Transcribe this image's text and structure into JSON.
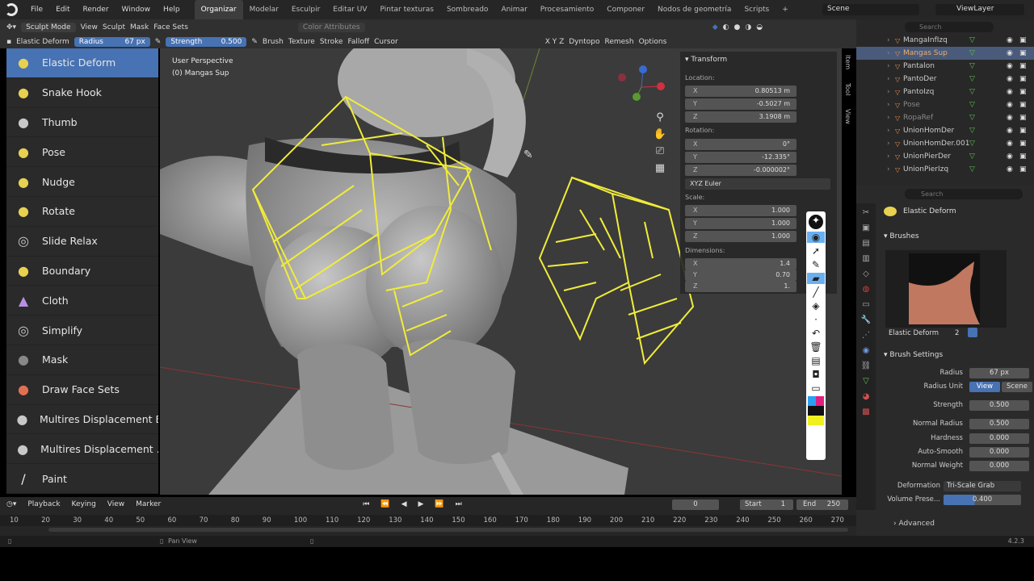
{
  "menu": [
    "File",
    "Edit",
    "Render",
    "Window",
    "Help"
  ],
  "workspaces": [
    "Organizar",
    "Modelar",
    "Esculpir",
    "Editar UV",
    "Pintar texturas",
    "Sombreado",
    "Animar",
    "Procesamiento",
    "Componer",
    "Nodos de geometría",
    "Scripts"
  ],
  "scene": "Scene",
  "view_layer": "ViewLayer",
  "outliner_search": "Search",
  "header": {
    "mode": "Sculpt Mode",
    "view": "View",
    "sculpt": "Sculpt",
    "mask": "Mask",
    "face_sets": "Face Sets",
    "color_attr": "Color Attributes"
  },
  "toolheader": {
    "brush_name": "Elastic Deform",
    "radius_label": "Radius",
    "radius_val": "67 px",
    "strength_label": "Strength",
    "strength_val": "0.500",
    "brush": "Brush",
    "texture": "Texture",
    "stroke": "Stroke",
    "falloff": "Falloff",
    "cursor": "Cursor",
    "axes": "X Y Z",
    "dyntopo": "Dyntopo",
    "remesh": "Remesh",
    "options": "Options"
  },
  "tools": [
    {
      "label": "Elastic Deform",
      "icon": "elastic-deform-icon",
      "glyph": "●",
      "color": "#e8d050"
    },
    {
      "label": "Snake Hook",
      "icon": "snake-hook-icon",
      "glyph": "●",
      "color": "#e8d050"
    },
    {
      "label": "Thumb",
      "icon": "thumb-icon",
      "glyph": "●",
      "color": "#c8c8c8"
    },
    {
      "label": "Pose",
      "icon": "pose-icon",
      "glyph": "●",
      "color": "#e8d050"
    },
    {
      "label": "Nudge",
      "icon": "nudge-icon",
      "glyph": "●",
      "color": "#e8d050"
    },
    {
      "label": "Rotate",
      "icon": "rotate-icon",
      "glyph": "●",
      "color": "#e8d050"
    },
    {
      "label": "Slide Relax",
      "icon": "slide-relax-icon",
      "glyph": "◎",
      "color": "#c8c8c8"
    },
    {
      "label": "Boundary",
      "icon": "boundary-icon",
      "glyph": "●",
      "color": "#e8d050"
    },
    {
      "label": "Cloth",
      "icon": "cloth-icon",
      "glyph": "▲",
      "color": "#b890e0"
    },
    {
      "label": "Simplify",
      "icon": "simplify-icon",
      "glyph": "◎",
      "color": "#c8c8c8"
    },
    {
      "label": "Mask",
      "icon": "mask-icon",
      "glyph": "●",
      "color": "#888888"
    },
    {
      "label": "Draw Face Sets",
      "icon": "draw-face-sets-icon",
      "glyph": "●",
      "color": "#e07050"
    },
    {
      "label": "Multires Displacement E...",
      "icon": "multires-eraser-icon",
      "glyph": "●",
      "color": "#c8c8c8"
    },
    {
      "label": "Multires Displacement ...",
      "icon": "multires-smear-icon",
      "glyph": "●",
      "color": "#c8c8c8"
    },
    {
      "label": "Paint",
      "icon": "paint-icon",
      "glyph": "/",
      "color": "#e8e8e8"
    }
  ],
  "viewport": {
    "perspective": "User Perspective",
    "object": "(0) Mangas Sup"
  },
  "npanel": {
    "transform": "Transform",
    "location": "Location:",
    "loc": [
      "0.80513 m",
      "-0.5027 m",
      "3.1908 m"
    ],
    "rotation": "Rotation:",
    "rot": [
      "0°",
      "-12.335°",
      "-0.000002°"
    ],
    "euler": "XYZ Euler",
    "scale": "Scale:",
    "scl": [
      "1.000",
      "1.000",
      "1.000"
    ],
    "dimensions": "Dimensions:",
    "dim": [
      "1.4",
      "0.70",
      "1."
    ],
    "tabs": [
      "Item",
      "Tool",
      "View"
    ]
  },
  "outliner": [
    {
      "label": "MangaInfIzq",
      "sel": false,
      "dim": false
    },
    {
      "label": "Mangas Sup",
      "sel": true,
      "dim": false
    },
    {
      "label": "Pantalon",
      "sel": false,
      "dim": false
    },
    {
      "label": "PantoDer",
      "sel": false,
      "dim": false
    },
    {
      "label": "PantoIzq",
      "sel": false,
      "dim": false
    },
    {
      "label": "Pose",
      "sel": false,
      "dim": true
    },
    {
      "label": "RopaRef",
      "sel": false,
      "dim": true
    },
    {
      "label": "UnionHomDer",
      "sel": false,
      "dim": false
    },
    {
      "label": "UnionHomDer.001",
      "sel": false,
      "dim": false
    },
    {
      "label": "UnionPierDer",
      "sel": false,
      "dim": false
    },
    {
      "label": "UnionPierIzq",
      "sel": false,
      "dim": false
    }
  ],
  "props": {
    "search": "Search",
    "brush_title": "Elastic Deform",
    "brushes": "Brushes",
    "preview_name": "Elastic Deform",
    "users": "2",
    "brush_settings": "Brush Settings",
    "rows": [
      {
        "label": "Radius",
        "value": "67 px",
        "blue": false
      },
      {
        "label": "Radius Unit",
        "value": "View",
        "value2": "Scene",
        "blue": true
      },
      {
        "label": "Strength",
        "value": "0.500",
        "blue": false
      },
      {
        "label": "Normal Radius",
        "value": "0.500",
        "blue": false
      },
      {
        "label": "Hardness",
        "value": "0.000",
        "blue": false
      },
      {
        "label": "Auto-Smooth",
        "value": "0.000",
        "blue": false
      },
      {
        "label": "Normal Weight",
        "value": "0.000",
        "blue": false
      }
    ],
    "deformation_label": "Deformation",
    "deformation": "Tri-Scale Grab",
    "volume_label": "Volume Prese...",
    "volume": "0.400",
    "advanced": "Advanced"
  },
  "timeline": {
    "menus": [
      "Playback",
      "Keying",
      "View",
      "Marker"
    ],
    "frame": "0",
    "start_label": "Start",
    "start": "1",
    "end_label": "End",
    "end": "250",
    "ticks": [
      "10",
      "20",
      "30",
      "40",
      "50",
      "60",
      "70",
      "80",
      "90",
      "100",
      "110",
      "120",
      "130",
      "140",
      "150",
      "160",
      "170",
      "180",
      "190",
      "200",
      "210",
      "220",
      "230",
      "240",
      "250",
      "260",
      "270"
    ]
  },
  "status": {
    "pan": "Pan View",
    "version": "4.2.3"
  },
  "colors": {
    "accent": "#4772b3",
    "sketch": "#f0ec3a",
    "bg": "#3b3b3b"
  }
}
